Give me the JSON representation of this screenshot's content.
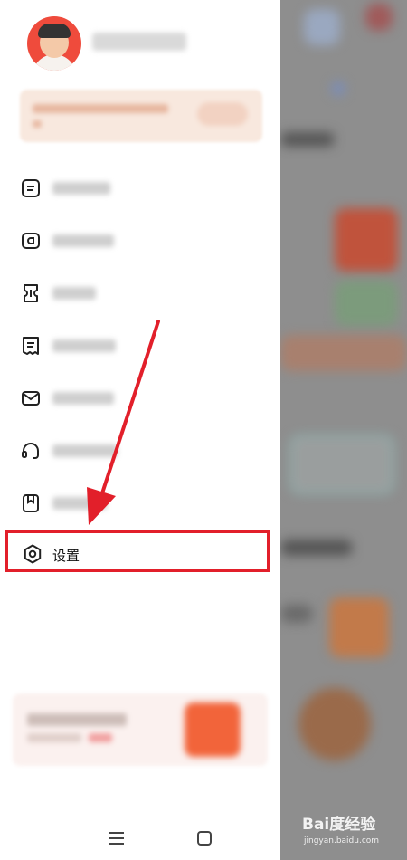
{
  "settings": {
    "label": "设置"
  },
  "menu": {
    "icons": [
      "list-doc-icon",
      "wallet-icon",
      "ticket-icon",
      "receipt-icon",
      "mail-icon",
      "headset-icon",
      "bookmark-icon"
    ]
  },
  "watermark": {
    "main": "Bai度经验",
    "sub": "jingyan.baidu.com"
  },
  "colors": {
    "highlight": "#e21f2a",
    "arrow": "#e21f2a",
    "overlay": "#8e8e8e",
    "avatar_bg": "#ef4b3c"
  }
}
